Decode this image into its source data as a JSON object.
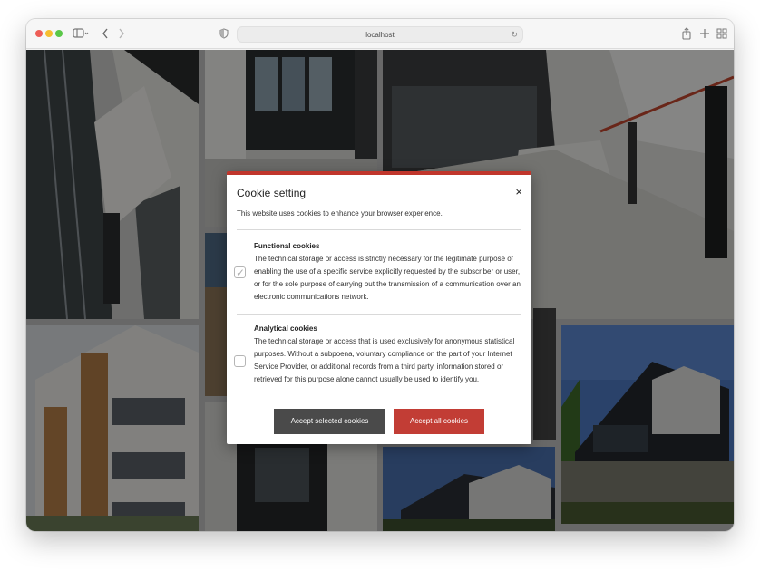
{
  "browser": {
    "url": "localhost"
  },
  "icons": {
    "sidebar": "sidebar-icon",
    "back": "chevron-left-icon",
    "forward": "chevron-right-icon",
    "shield": "privacy-shield-icon",
    "reload": "reload-icon",
    "share": "share-icon",
    "new_tab": "plus-icon",
    "tabs": "tab-overview-icon"
  },
  "cookie_dialog": {
    "title": "Cookie setting",
    "close_label": "×",
    "intro": "This website uses cookies to enhance your browser experience.",
    "functional": {
      "title": "Functional cookies",
      "text": "The technical storage or access is strictly necessary for the legitimate purpose of enabling the use of a specific service explicitly requested by the subscriber or user, or for the sole purpose of carrying out the transmission of a communication over an electronic communications network.",
      "checked": true
    },
    "analytical": {
      "title": "Analytical cookies",
      "text": "The technical storage or access that is used exclusively for anonymous statistical purposes. Without a subpoena, voluntary compliance on the part of your Internet Service Provider, or additional records from a third party, information stored or retrieved for this purpose alone cannot usually be used to identify you.",
      "checked": false
    },
    "accept_selected": "Accept selected cookies",
    "accept_all": "Accept all cookies"
  },
  "colors": {
    "accent": "#c0362c",
    "button_dark": "#4a4a4a",
    "button_red": "#c23d35"
  }
}
